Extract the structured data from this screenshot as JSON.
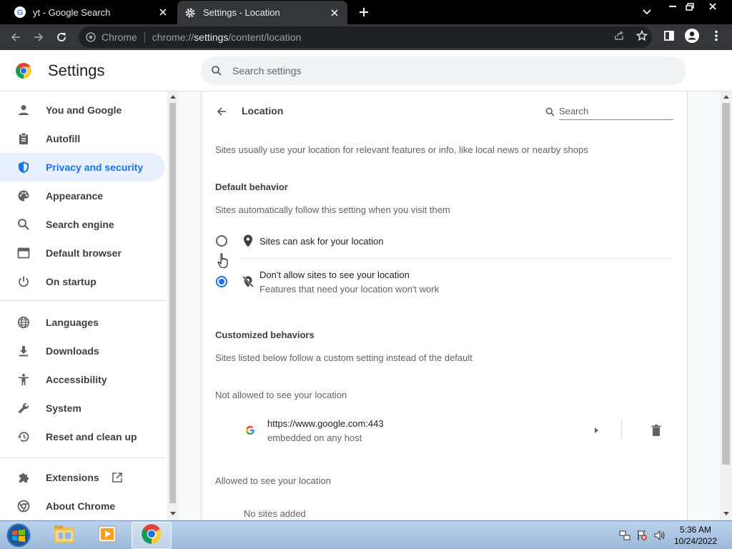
{
  "browser": {
    "tabs": [
      {
        "title": "yt - Google Search",
        "icon": "google-g-icon",
        "active": false
      },
      {
        "title": "Settings - Location",
        "icon": "gear-icon",
        "active": true
      }
    ],
    "omnibox": {
      "label": "Chrome",
      "url_prefix": "chrome://",
      "url_host": "settings",
      "url_path": "/content/location"
    }
  },
  "header": {
    "title": "Settings",
    "search_placeholder": "Search settings"
  },
  "sidebar": {
    "items": [
      {
        "label": "You and Google",
        "icon": "person-icon"
      },
      {
        "label": "Autofill",
        "icon": "clipboard-icon"
      },
      {
        "label": "Privacy and security",
        "icon": "shield-icon",
        "active": true
      },
      {
        "label": "Appearance",
        "icon": "palette-icon"
      },
      {
        "label": "Search engine",
        "icon": "search-icon"
      },
      {
        "label": "Default browser",
        "icon": "browser-window-icon"
      },
      {
        "label": "On startup",
        "icon": "power-icon"
      },
      {
        "label": "Languages",
        "icon": "globe-icon"
      },
      {
        "label": "Downloads",
        "icon": "download-icon"
      },
      {
        "label": "Accessibility",
        "icon": "accessibility-icon"
      },
      {
        "label": "System",
        "icon": "wrench-icon"
      },
      {
        "label": "Reset and clean up",
        "icon": "restore-icon"
      },
      {
        "label": "Extensions",
        "icon": "puzzle-icon"
      },
      {
        "label": "About Chrome",
        "icon": "chrome-logo-icon"
      }
    ]
  },
  "page": {
    "title": "Location",
    "search_placeholder": "Search",
    "description": "Sites usually use your location for relevant features or info, like local news or nearby shops",
    "default_behavior": {
      "heading": "Default behavior",
      "description": "Sites automatically follow this setting when you visit them",
      "options": [
        {
          "label": "Sites can ask for your location",
          "sublabel": "",
          "checked": false,
          "icon": "location-pin-icon"
        },
        {
          "label": "Don't allow sites to see your location",
          "sublabel": "Features that need your location won't work",
          "checked": true,
          "icon": "location-off-icon"
        }
      ]
    },
    "customized": {
      "heading": "Customized behaviors",
      "description": "Sites listed below follow a custom setting instead of the default",
      "not_allowed_label": "Not allowed to see your location",
      "not_allowed_sites": [
        {
          "url": "https://www.google.com:443",
          "sub": "embedded on any host"
        }
      ],
      "allowed_label": "Allowed to see your location",
      "allowed_empty": "No sites added"
    }
  },
  "taskbar": {
    "time": "5:36 AM",
    "date": "10/24/2022"
  },
  "colors": {
    "accent": "#1a73e8",
    "active_bg": "#e8f0fe"
  }
}
